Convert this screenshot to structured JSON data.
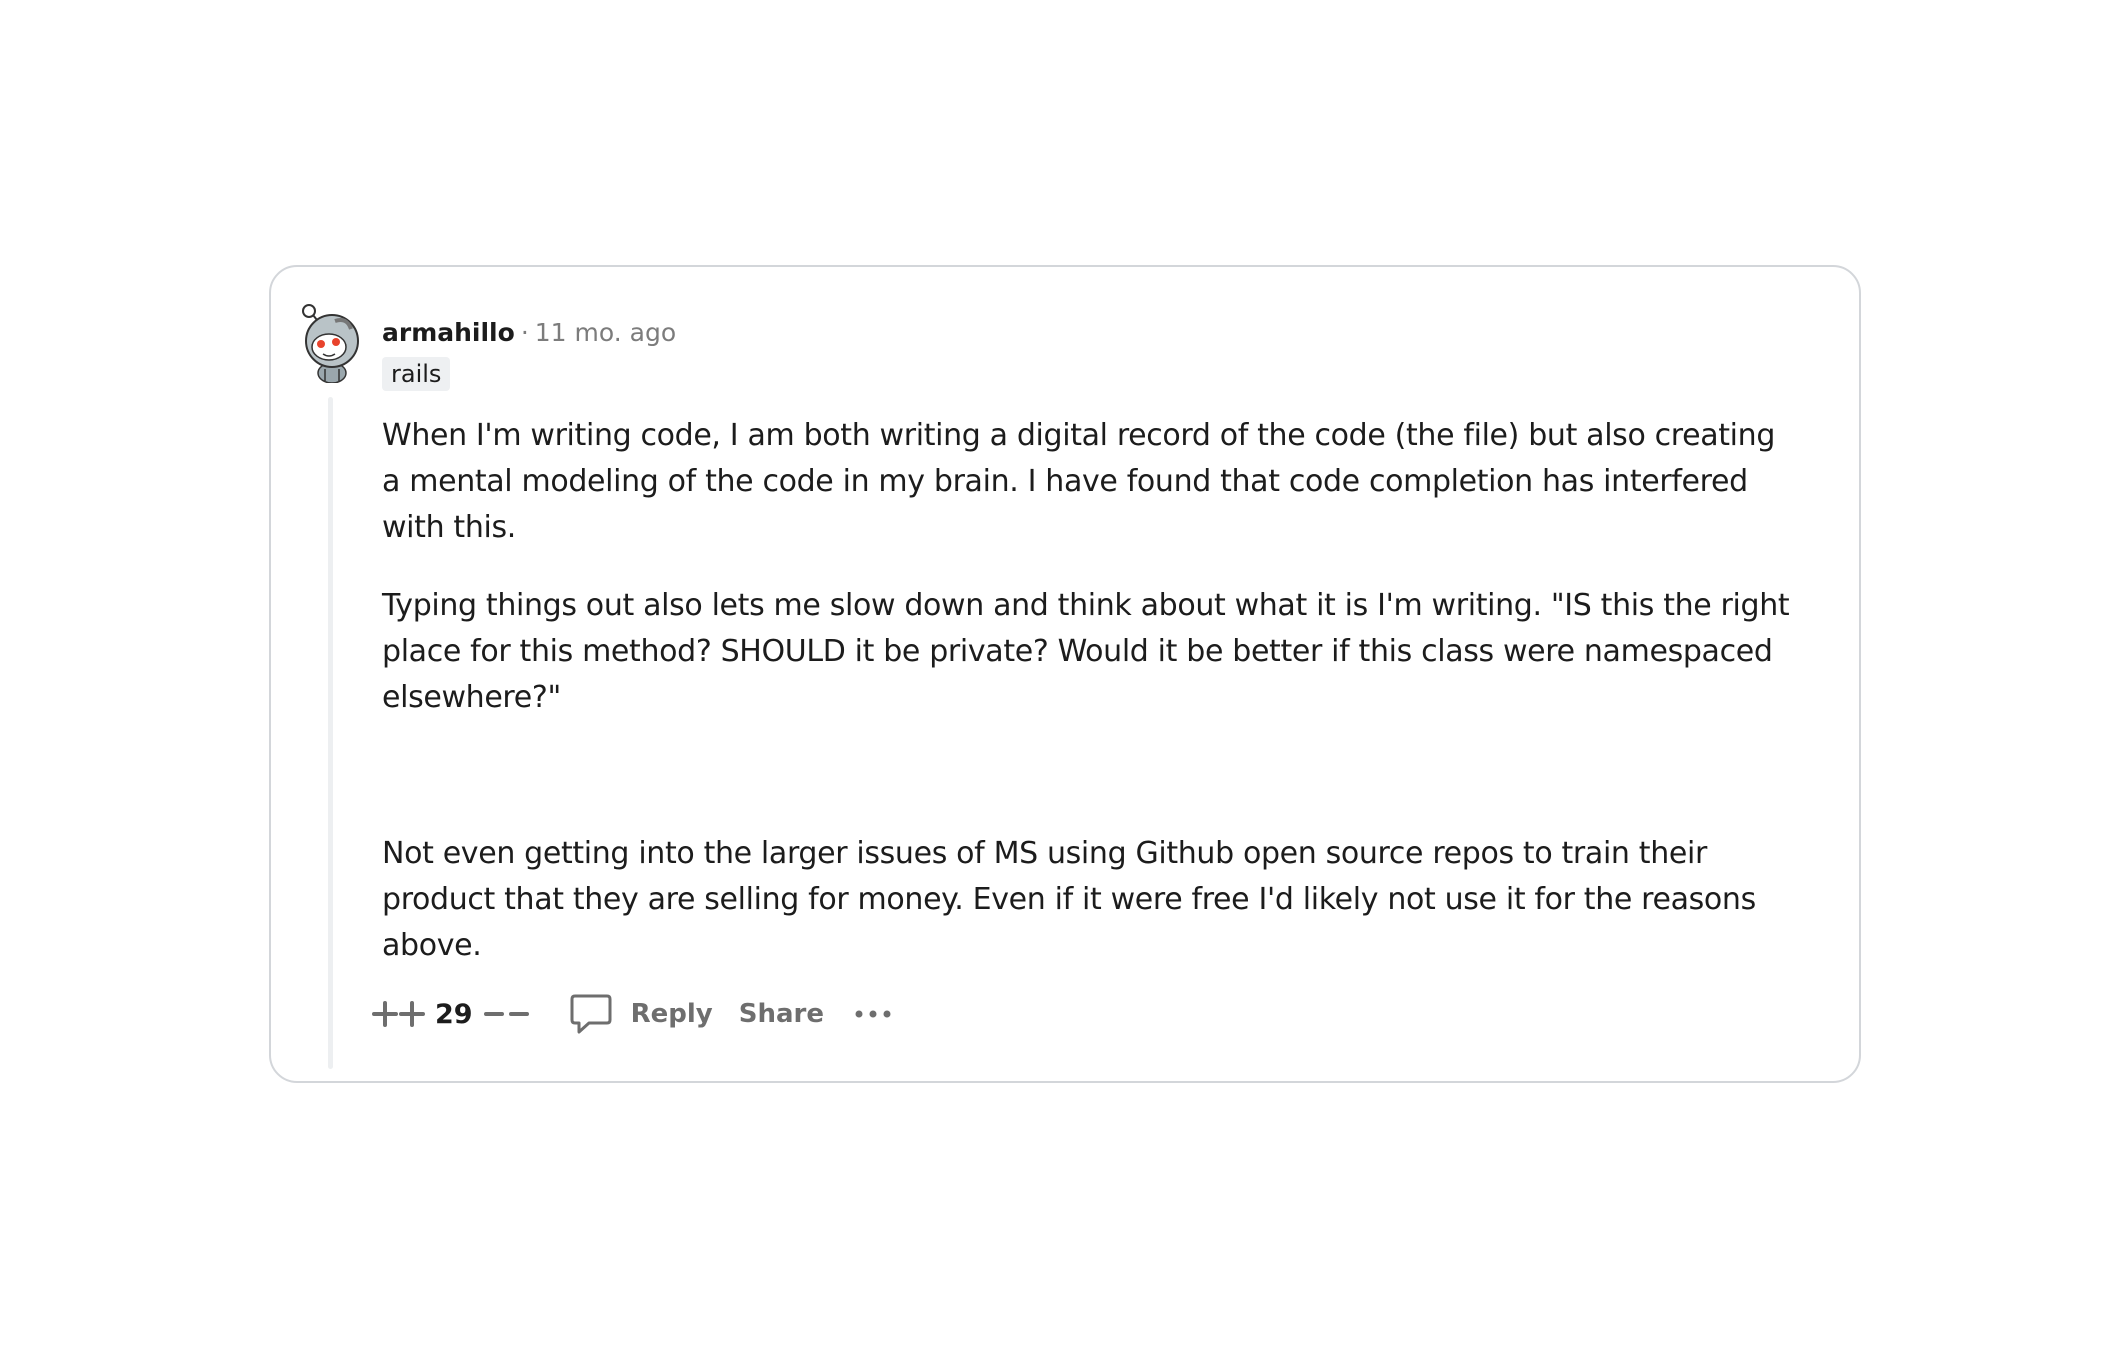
{
  "comment": {
    "username": "armahillo",
    "separator": "·",
    "timestamp": "11 mo. ago",
    "flair": "rails",
    "avatar_icon": "snoo-avatar-icon",
    "paragraphs": [
      {
        "segments": [
          "When I'm writing code, I am both writing a digital record of the code (the file) but also ",
          "creating a mental modeling of the code in my brain. I have found that code completion has interfered with",
          " this."
        ],
        "highlighted_segment_index": 1
      },
      {
        "text": "Typing things out also lets me slow down and think about what it is I'm writing. \"IS this the right place for this method? SHOULD it be private? Would it be better if this class were namespaced elsewhere?\""
      },
      {
        "text": "Not even getting into the larger issues of MS using Github open source repos to train their product that they are selling for money. Even if it were free I'd likely not use it for the reasons above."
      }
    ],
    "highlight_color": "#fbf255",
    "actions": {
      "vote_count": "29",
      "upvote_icon": "upvote-plus-icon",
      "downvote_icon": "downvote-minus-icon",
      "reply_icon": "speech-bubble-icon",
      "reply_label": "Reply",
      "share_label": "Share",
      "more_icon": "ellipsis-icon"
    }
  }
}
